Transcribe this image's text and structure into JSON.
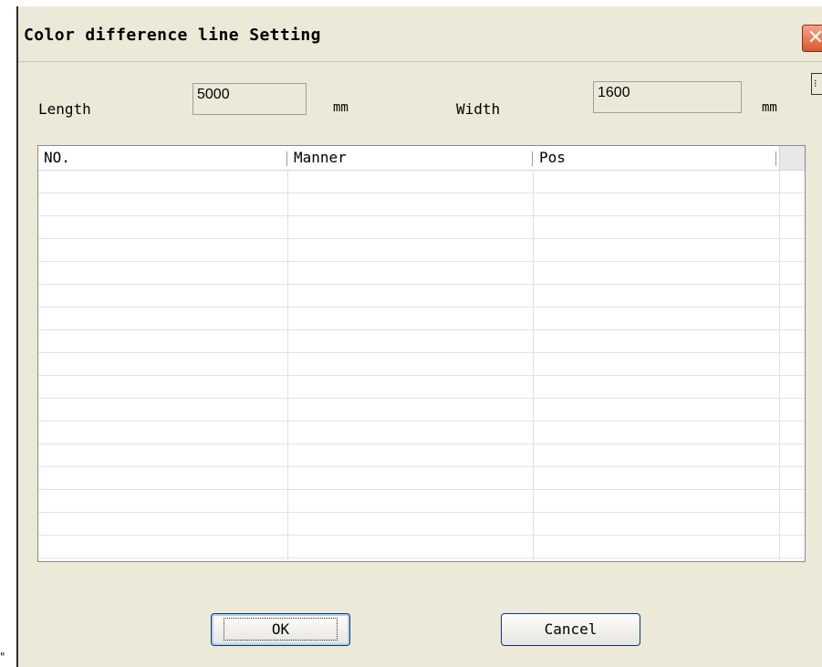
{
  "dialog": {
    "title": "Color difference line Setting",
    "close_symbol": "✕"
  },
  "size": {
    "length_label": "Length",
    "length_value": "5000",
    "length_unit": "mm",
    "width_label": "Width",
    "width_value": "1600",
    "width_unit": "mm"
  },
  "table": {
    "columns": [
      "NO.",
      "Manner",
      "Pos"
    ],
    "rows": []
  },
  "buttons": {
    "ok_label": "OK",
    "cancel_label": "Cancel"
  },
  "stray_mark": "\""
}
